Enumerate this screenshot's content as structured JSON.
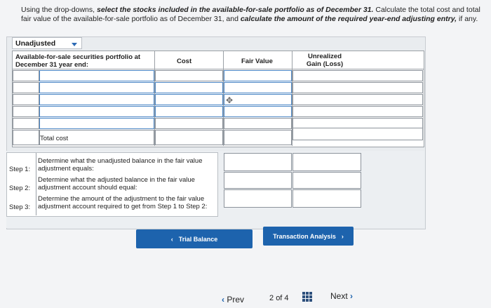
{
  "instructions": {
    "part1": "Using the drop-downs, ",
    "bold1": "select the stocks included in the available-for-sale portfolio as of December 31.",
    "part2": " Calculate the total cost and total fair value of the available-for-sale portfolio as of December 31, and ",
    "bold2": "calculate the amount of the required year-end adjusting entry,",
    "part3": " if any."
  },
  "dropdown": {
    "selected": "Unadjusted"
  },
  "table": {
    "headers": {
      "portfolio": "Available-for-sale securities portfolio at December 31 year end:",
      "cost": "Cost",
      "fair_value": "Fair Value",
      "unrealized": "Unrealized Gain (Loss)"
    },
    "total_label": "Total cost"
  },
  "steps": [
    {
      "label": "Step 1:",
      "text": "Determine what the unadjusted balance in the fair value adjustment equals:"
    },
    {
      "label": "Step 2:",
      "text": "Determine what the adjusted balance in the fair value adjustment account should equal:"
    },
    {
      "label": "Step 3:",
      "text": "Determine the amount of the adjustment to the fair value adjustment account required to get from Step 1 to Step 2:"
    }
  ],
  "buttons": {
    "trial_balance": "Trial Balance",
    "transaction_analysis": "Transaction Analysis"
  },
  "pagination": {
    "prev": "Prev",
    "current": "2",
    "of": "of 4",
    "next": "Next"
  }
}
